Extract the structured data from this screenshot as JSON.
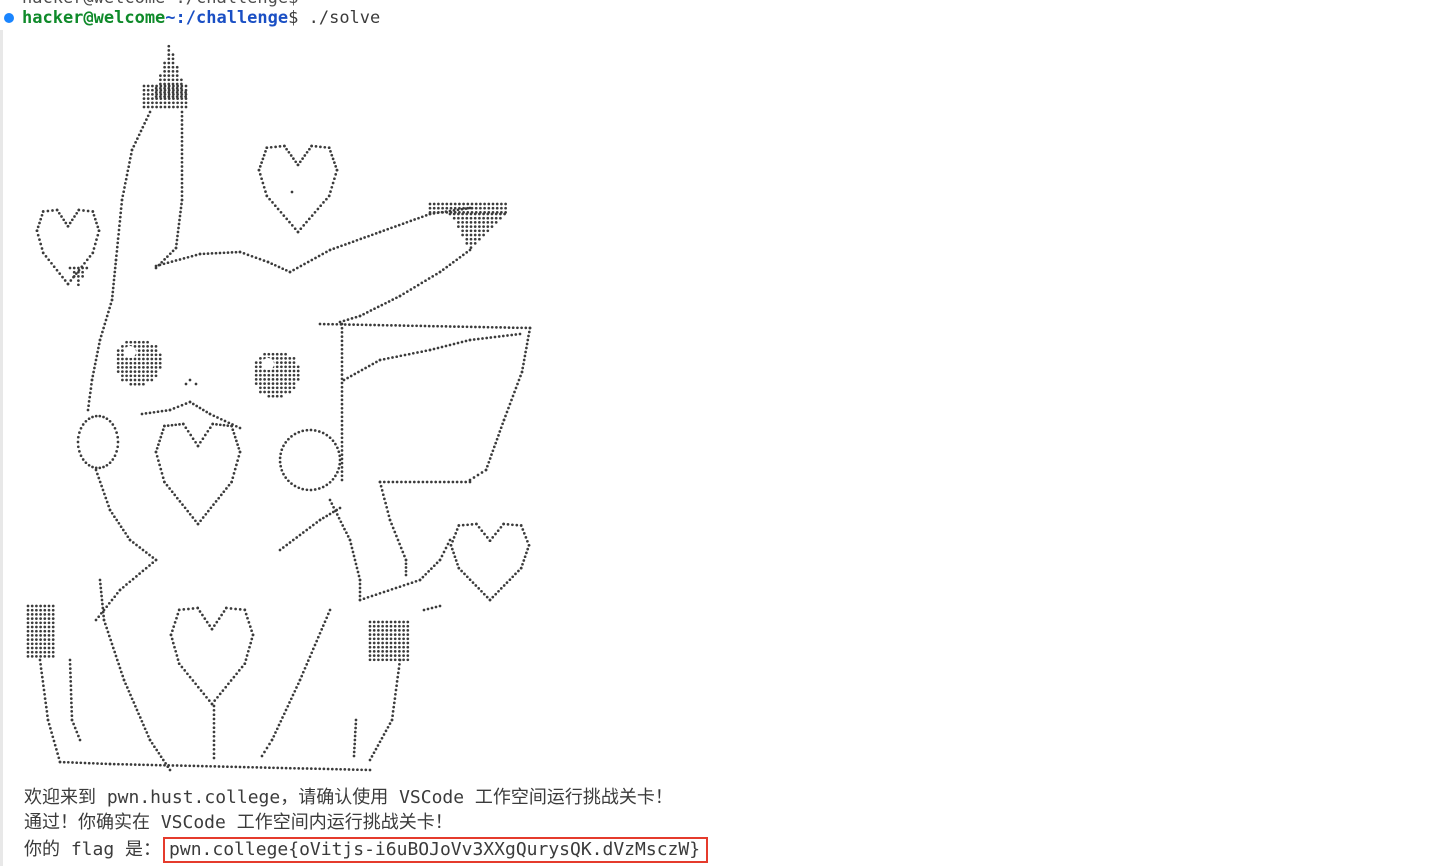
{
  "terminal": {
    "previous_line_fragment": "hacker@welcome~:/challenge$",
    "prompt": {
      "user_host": "hacker@welcome",
      "tilde_path": "~:/challenge",
      "dollar": "$",
      "command": " ./solve"
    },
    "ascii_art_subject": "pikachu-with-hearts",
    "output": {
      "line1": "欢迎来到 pwn.hust.college，请确认使用 VSCode 工作空间运行挑战关卡！",
      "line2": "通过！你确实在 VSCode 工作空间内运行挑战关卡！",
      "line3_prefix": "你的 flag 是：",
      "flag": "pwn.college{oVitjs-i6uBOJoVv3XXgQurysQK.dVzMsczW}"
    }
  },
  "colors": {
    "status_dot": "#1a85ff",
    "user_host": "#0f8a2a",
    "path": "#1a4fc4",
    "flag_box_border": "#e53b2c",
    "text": "#3b3b3b"
  }
}
